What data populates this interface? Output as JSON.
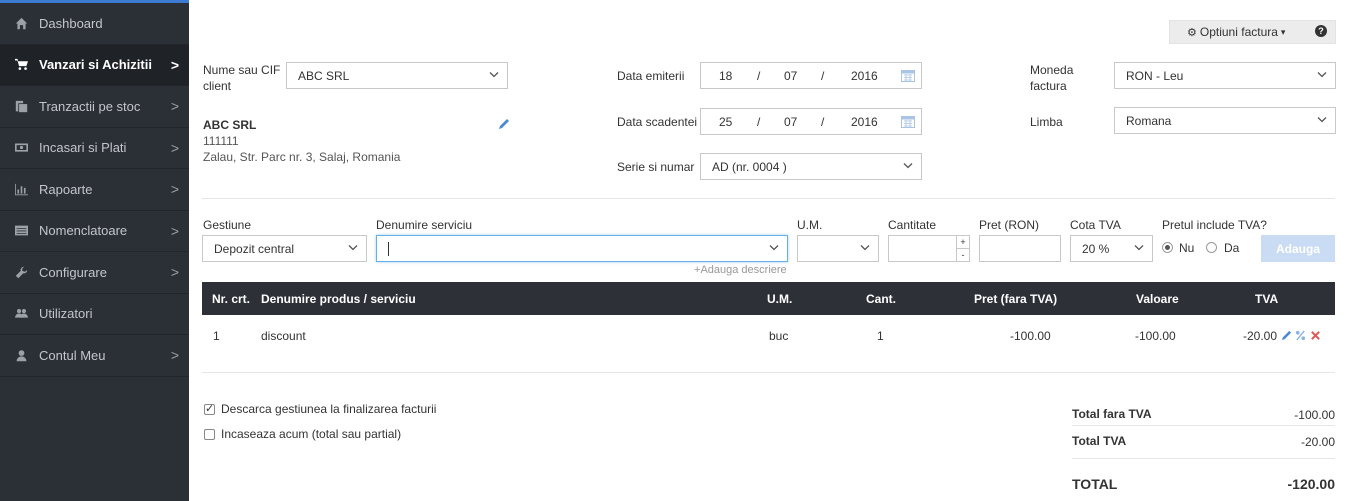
{
  "sidebar": {
    "items": [
      {
        "label": "Dashboard",
        "icon": "home-icon",
        "chevron": false
      },
      {
        "label": "Vanzari si Achizitii",
        "icon": "cart-icon",
        "chevron": true,
        "active": true
      },
      {
        "label": "Tranzactii pe stoc",
        "icon": "copy-icon",
        "chevron": true
      },
      {
        "label": "Incasari si Plati",
        "icon": "money-icon",
        "chevron": true
      },
      {
        "label": "Rapoarte",
        "icon": "bar-chart-icon",
        "chevron": true
      },
      {
        "label": "Nomenclatoare",
        "icon": "list-icon",
        "chevron": true
      },
      {
        "label": "Configurare",
        "icon": "wrench-icon",
        "chevron": true
      },
      {
        "label": "Utilizatori",
        "icon": "users-icon",
        "chevron": false
      },
      {
        "label": "Contul Meu",
        "icon": "user-icon",
        "chevron": true
      }
    ],
    "chevron": ">"
  },
  "header": {
    "options_label": "Optiuni factura",
    "help": "?"
  },
  "client": {
    "label_line1": "Nume sau CIF",
    "label_line2": "client",
    "value": "ABC SRL",
    "name": "ABC SRL",
    "cif": "111111",
    "address": "Zalau, Str. Parc nr. 3, Salaj, Romania"
  },
  "dates": {
    "issue_label": "Data emiterii",
    "issue_day": "18",
    "issue_month": "07",
    "issue_year": "2016",
    "due_label": "Data scadentei",
    "due_day": "25",
    "due_month": "07",
    "due_year": "2016",
    "sep": "/"
  },
  "series": {
    "label": "Serie si numar",
    "value": "AD (nr. 0004 )"
  },
  "currency": {
    "label_line1": "Moneda",
    "label_line2": "factura",
    "value": "RON - Leu"
  },
  "language": {
    "label": "Limba",
    "value": "Romana"
  },
  "line_form": {
    "gestiune_label": "Gestiune",
    "gestiune_value": "Depozit central",
    "service_label": "Denumire serviciu",
    "service_value": "",
    "um_label": "U.M.",
    "qty_label": "Cantitate",
    "price_label": "Pret (RON)",
    "vat_label": "Cota TVA",
    "vat_value": "20 %",
    "incl_label": "Pretul include TVA?",
    "opt_no": "Nu",
    "opt_yes": "Da",
    "add_button": "Adauga",
    "add_desc": "Adauga descriere",
    "plus": "+",
    "minus": "-"
  },
  "table": {
    "headers": [
      "Nr. crt.",
      "Denumire produs / serviciu",
      "U.M.",
      "Cant.",
      "Pret (fara TVA)",
      "Valoare",
      "TVA"
    ],
    "rows": [
      {
        "nr": "1",
        "name": "discount",
        "um": "buc",
        "qty": "1",
        "price": "-100.00",
        "value": "-100.00",
        "vat": "-20.00"
      }
    ]
  },
  "options": {
    "discharge_label": "Descarca gestiunea la finalizarea facturii",
    "discharge_checked": true,
    "collect_label": "Incaseaza acum (total sau partial)",
    "collect_checked": false
  },
  "totals": {
    "net_label": "Total fara TVA",
    "net_value": "-100.00",
    "vat_label": "Total TVA",
    "vat_value": "-20.00",
    "total_label": "TOTAL",
    "total_value": "-120.00"
  },
  "colors": {
    "sidebar_bg": "#2b2f36",
    "accent": "#3b7bd4",
    "table_header_bg": "#2d3037",
    "add_button_bg": "#c9dcf3",
    "delete_red": "#e05555",
    "edit_blue": "#4a8ad4"
  }
}
